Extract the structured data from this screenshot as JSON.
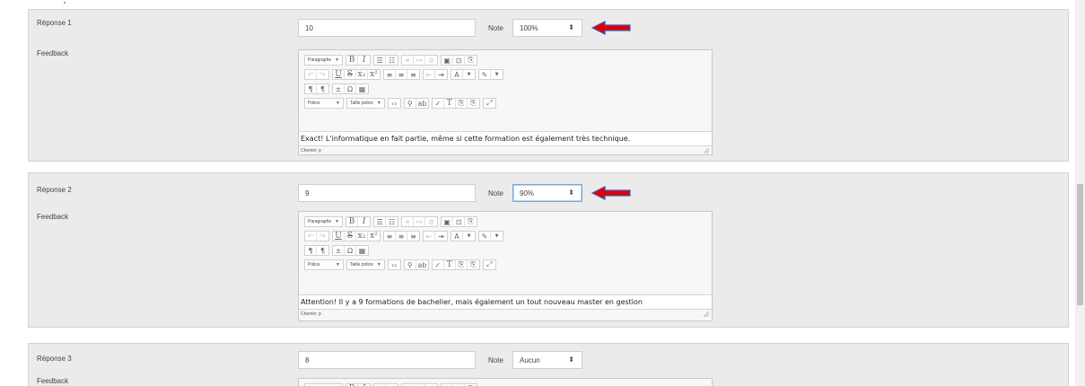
{
  "note_label": "Note",
  "editor": {
    "paragraph_label": "Paragraphe",
    "font_label": "Police",
    "size_label": "Taille police"
  },
  "answers": [
    {
      "label": "Réponse 1",
      "feedback_label": "Feedback",
      "value": "10",
      "grade": "100%",
      "feedback_text": "Exact! L'informatique en fait partie, même si cette formation est également très technique.",
      "path": "Chemin: p"
    },
    {
      "label": "Réponse 2",
      "feedback_label": "Feedback",
      "value": "9",
      "grade": "90%",
      "feedback_text": "Attention! Il y a 9 formations de bachelier, mais également un tout nouveau master en gestion",
      "path": "Chemin: p"
    },
    {
      "label": "Réponse 3",
      "feedback_label": "Feedback",
      "value": "8",
      "grade": "Aucun"
    }
  ],
  "colors": {
    "block_bg": "#ebebeb",
    "arrow_red": "#e00000",
    "arrow_outline": "#3a5bbf",
    "focus_border": "#7aa7d8"
  }
}
